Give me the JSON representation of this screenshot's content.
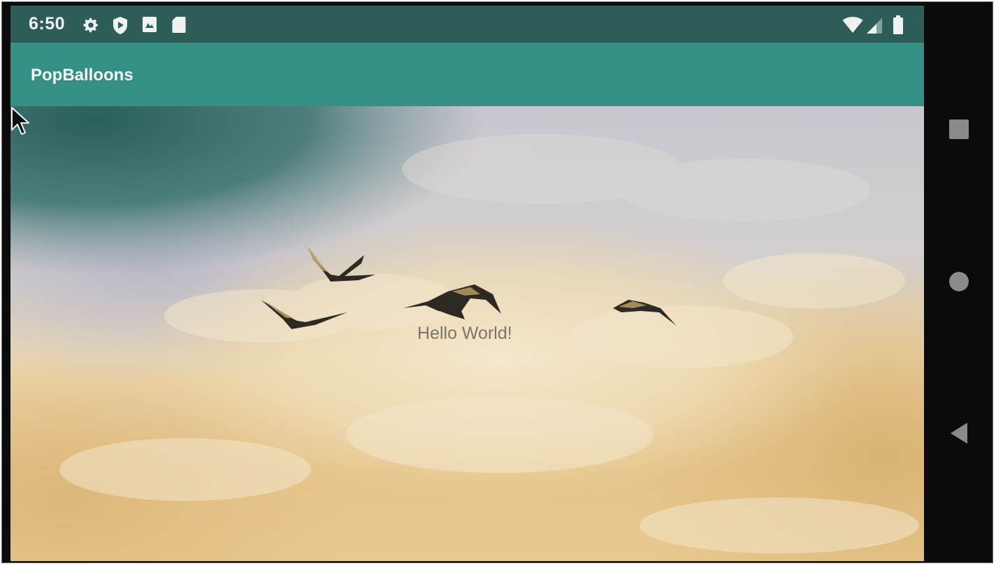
{
  "status_bar": {
    "time": "6:50",
    "left_icons": [
      "gear-icon",
      "shield-play-icon",
      "image-icon",
      "sd-card-icon"
    ],
    "right_icons": [
      "wifi-icon",
      "cell-signal-icon",
      "battery-icon"
    ]
  },
  "app_bar": {
    "title": "PopBalloons"
  },
  "content": {
    "hello_text": "Hello World!"
  },
  "nav_bar": {
    "buttons": [
      "recents-icon",
      "home-icon",
      "back-icon"
    ]
  },
  "colors": {
    "status_bar": "#2e5d58",
    "app_bar": "#348f85",
    "nav_bar": "#0b0b0b"
  }
}
